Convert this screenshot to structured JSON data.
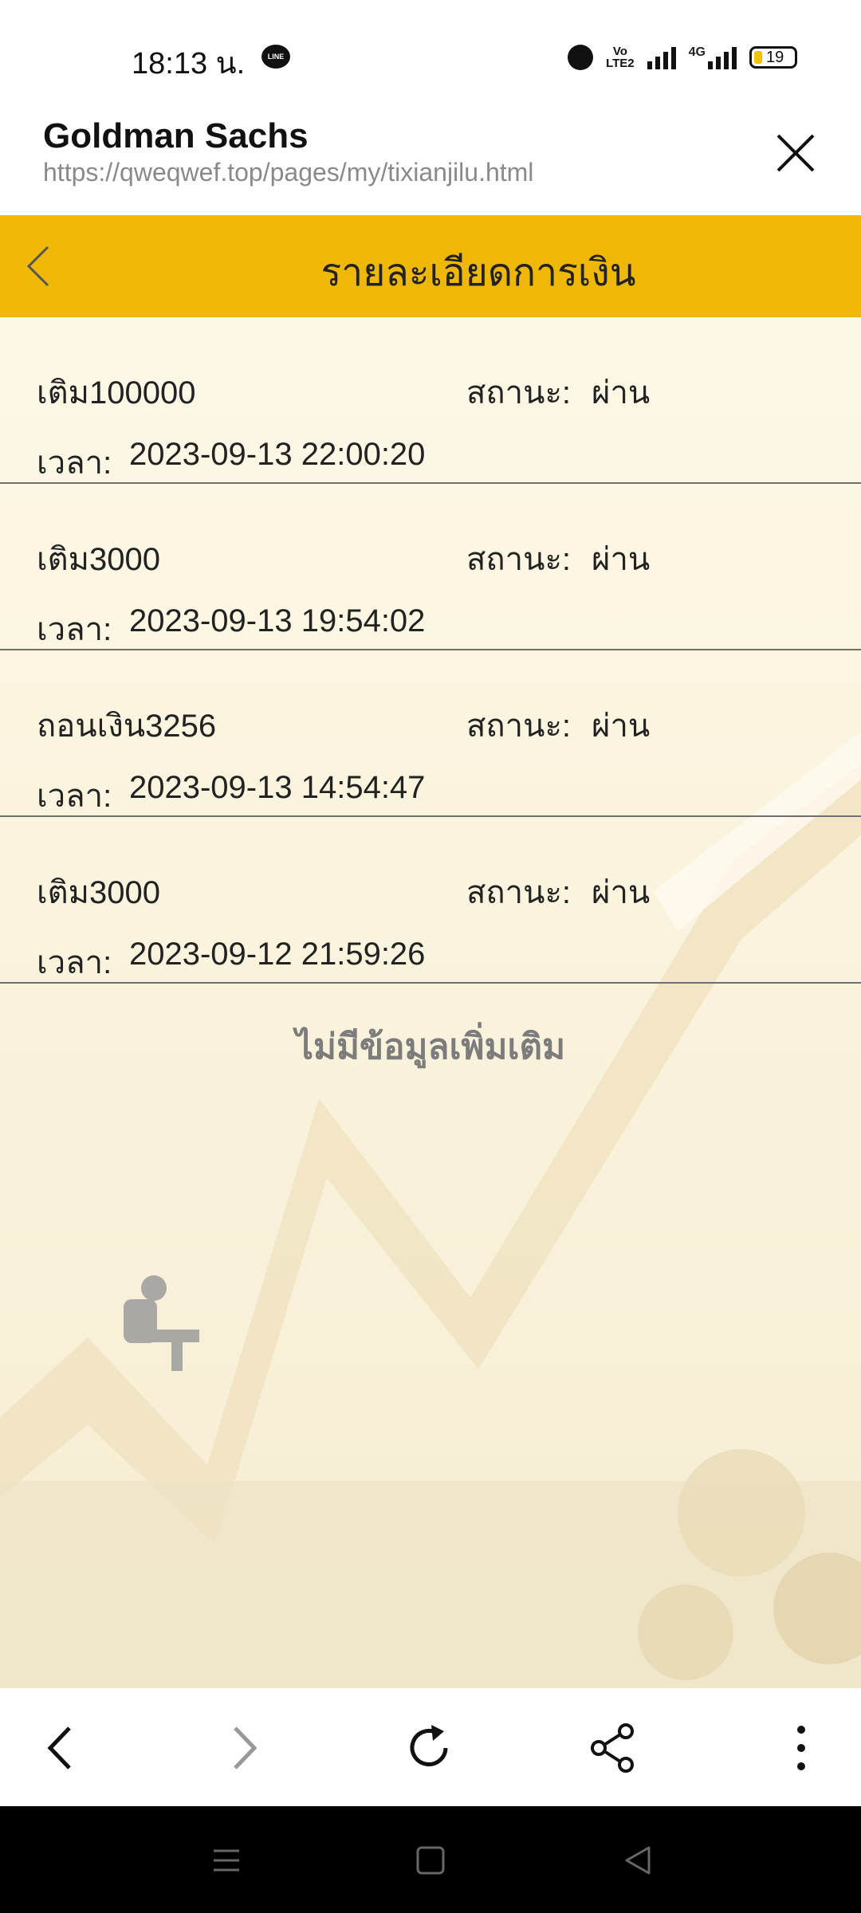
{
  "status_bar": {
    "time": "18:13 น.",
    "line_badge": "LINE",
    "volte": "VoLTE2",
    "network": "4G",
    "battery": "19"
  },
  "browser": {
    "title": "Goldman Sachs",
    "url": "https://qweqwef.top/pages/my/tixianjilu.html",
    "close_icon": "close-icon"
  },
  "page": {
    "title": "รายละเอียดการเงิน",
    "back_icon": "chevron-left-icon",
    "header_color": "#efb806",
    "status_label": "สถานะ:",
    "time_label": "เวลา:",
    "records": [
      {
        "name": "เติม100000",
        "status": "ผ่าน",
        "time": "2023-09-13 22:00:20"
      },
      {
        "name": "เติม3000",
        "status": "ผ่าน",
        "time": "2023-09-13 19:54:02"
      },
      {
        "name": "ถอนเงิน3256",
        "status": "ผ่าน",
        "time": "2023-09-13 14:54:47"
      },
      {
        "name": "เติม3000",
        "status": "ผ่าน",
        "time": "2023-09-12 21:59:26"
      }
    ],
    "no_more": "ไม่มีข้อมูลเพิ่มเติม"
  },
  "bottom_bar": {
    "icons": [
      "back-arrow-icon",
      "forward-arrow-icon",
      "refresh-icon",
      "share-icon",
      "more-vert-icon"
    ]
  },
  "android_nav": {
    "icons": [
      "menu-icon",
      "home-icon",
      "back-triangle-icon"
    ]
  }
}
